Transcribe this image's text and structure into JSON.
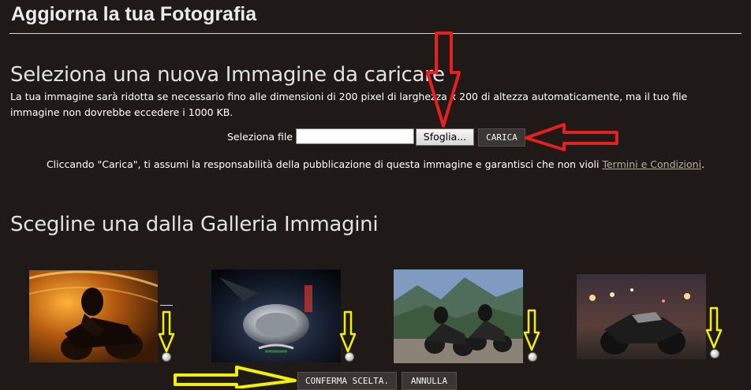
{
  "page": {
    "title": "Aggiorna la tua Fotografia"
  },
  "upload": {
    "heading": "Seleziona una nuova Immagine da caricare",
    "description": "La tua immagine sarà ridotta se necessario fino alle dimensioni di 200 pixel di larghezza x 200 di altezza automaticamente, ma il tuo file immagine non dovrebbe eccedere i 1000 KB.",
    "file_label": "Seleziona file",
    "file_value": "",
    "browse_label": "Sfoglia...",
    "upload_label": "CARICA",
    "terms_prefix": "Cliccando \"Carica\", ti assumi la responsabilità della pubblicazione di questa immagine e garantisci che non violi ",
    "terms_link": "Termini e Condizioni",
    "terms_suffix": "."
  },
  "gallery": {
    "heading": "Scegline una dalla Galleria Immagini",
    "items": [
      {
        "name": "motorbike-tunnel-photo",
        "selected": false
      },
      {
        "name": "fuel-tank-closeup-photo",
        "selected": false
      },
      {
        "name": "two-riders-mountain-photo",
        "selected": false
      },
      {
        "name": "motorbike-city-night-photo",
        "selected": false
      }
    ],
    "confirm_label": "CONFERMA SCELTA.",
    "cancel_label": "ANNULLA"
  },
  "colors": {
    "background": "#1f1a17",
    "button_dark": "#3a3633",
    "link": "#b8aba0",
    "annotation_red": "#e81f1f",
    "annotation_yellow": "#f5f000"
  },
  "icons": [
    "red-arrow-down-icon",
    "red-arrow-left-icon",
    "yellow-arrow-down-icon",
    "yellow-arrow-right-icon"
  ]
}
